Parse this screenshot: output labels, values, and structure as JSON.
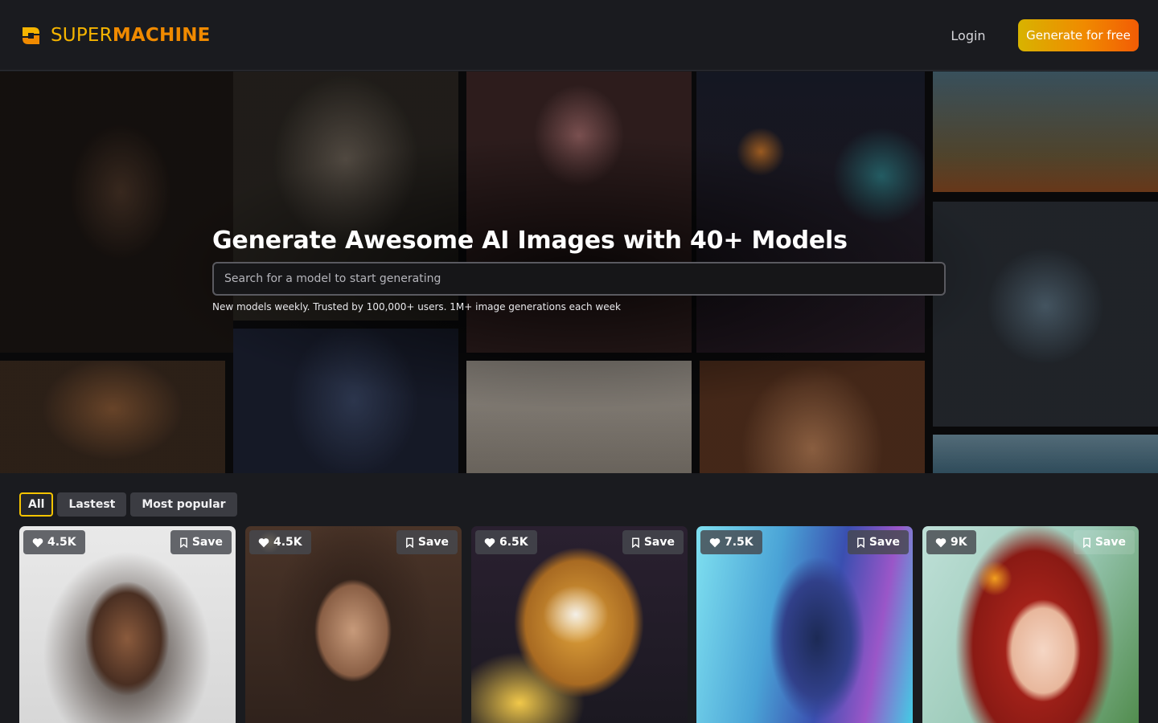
{
  "header": {
    "logo_part1": "SUPER",
    "logo_part2": "MACHINE",
    "login_label": "Login",
    "cta_label": "Generate for free"
  },
  "hero": {
    "title": "Generate Awesome AI Images with 40+ Models",
    "search_placeholder": "Search for a model to start generating",
    "subtitle": "New models weekly. Trusted by 100,000+ users. 1M+ image generations each week"
  },
  "filters": {
    "items": [
      "All",
      "Lastest",
      "Most popular"
    ],
    "active": "All"
  },
  "cards": [
    {
      "likes": "4.5K",
      "save_label": "Save",
      "subject": "portrait woman curly hair hoodie"
    },
    {
      "likes": "4.5K",
      "save_label": "Save",
      "subject": "woman with glasses in cafe"
    },
    {
      "likes": "6.5K",
      "save_label": "Save",
      "subject": "cartoon mouse with cheese"
    },
    {
      "likes": "7.5K",
      "save_label": "Save",
      "subject": "neon futuristic tower"
    },
    {
      "likes": "9K",
      "save_label": "Save",
      "subject": "anime girl red hair flowers"
    }
  ],
  "colors": {
    "background": "#1a1b1f",
    "accent_yellow": "#f5b400",
    "accent_orange": "#f08a00",
    "chip_bg": "#3b3c42"
  },
  "icons": [
    "logo-mark-icon",
    "heart-icon",
    "bookmark-icon"
  ]
}
